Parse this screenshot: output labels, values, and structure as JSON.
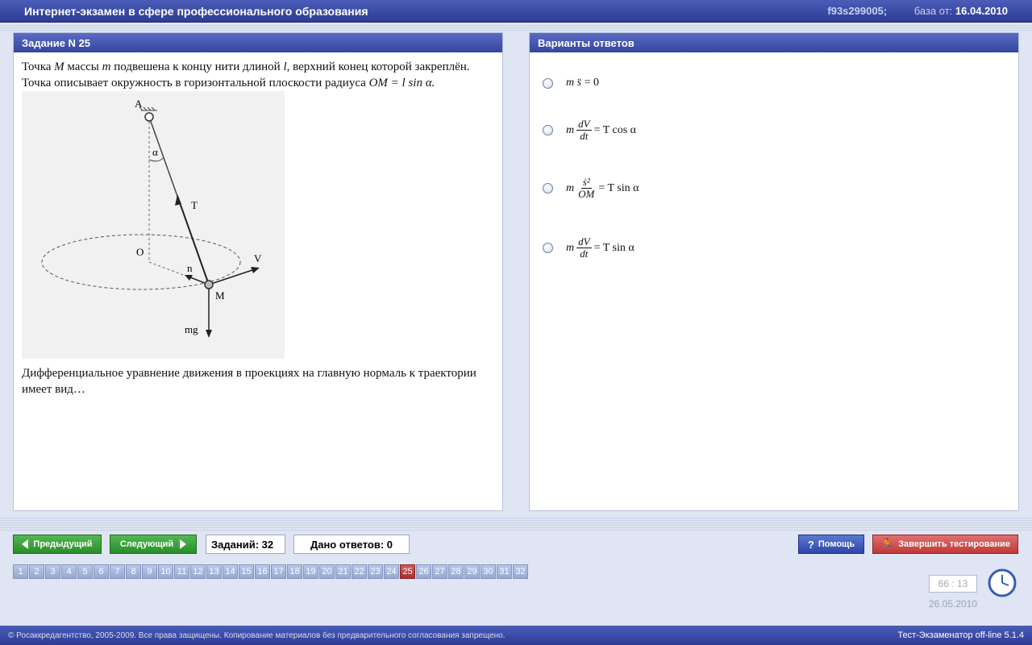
{
  "header": {
    "title": "Интернет-экзамен в сфере профессионального образования",
    "code": "f93s299005;",
    "base_label": "база от:",
    "base_date": "16.04.2010"
  },
  "question": {
    "title": "Задание N 25",
    "line1_a": "Точка ",
    "line1_M": "M",
    "line1_b": " массы ",
    "line1_m": "m",
    "line1_c": " подвешена к концу нити длиной ",
    "line1_l": "l",
    "line1_d": ", верхний конец которой закреплён.",
    "line2_a": "Точка описывает окружность в горизонтальной плоскости радиуса ",
    "line2_formula": "OM = l sin α.",
    "line3": "Дифференциальное уравнение движения в проекциях на главную нормаль к траектории",
    "line4": "имеет вид…",
    "figure_labels": {
      "A": "A",
      "alpha": "α",
      "T": "T",
      "O": "O",
      "n": "n",
      "V": "V",
      "M": "M",
      "mg": "mg"
    }
  },
  "answers": {
    "title": "Варианты ответов",
    "options": [
      {
        "parts": [
          "m",
          "s̈",
          "= 0"
        ]
      },
      {
        "pre": "m",
        "num": "dV",
        "den": "dt",
        "post": "= T cos α"
      },
      {
        "pre": "m",
        "num": "ṡ²",
        "den": "OM",
        "post": "= T sin α"
      },
      {
        "pre": "m",
        "num": "dV",
        "den": "dt",
        "post": "= T sin α"
      }
    ]
  },
  "nav": {
    "prev": "Предыдущий",
    "next": "Следующий",
    "tasks": "Заданий: 32",
    "answered": "Дано ответов: 0",
    "help": "Помощь",
    "finish": "Завершить тестирование",
    "current": 25,
    "total": 32
  },
  "timer": {
    "value": "66 : 13",
    "date": "26.05.2010"
  },
  "footer": {
    "copyright": "© Росаккредагентство, 2005-2009. Все права защищены. Копирование материалов без предварительного согласования запрещено.",
    "version": "Тест-Экзаменатор off-line 5.1.4"
  },
  "colors": {
    "header": "#3444a0",
    "current_task": "#c04040",
    "green_button": "#2a8d2a",
    "red_button": "#c03838"
  }
}
